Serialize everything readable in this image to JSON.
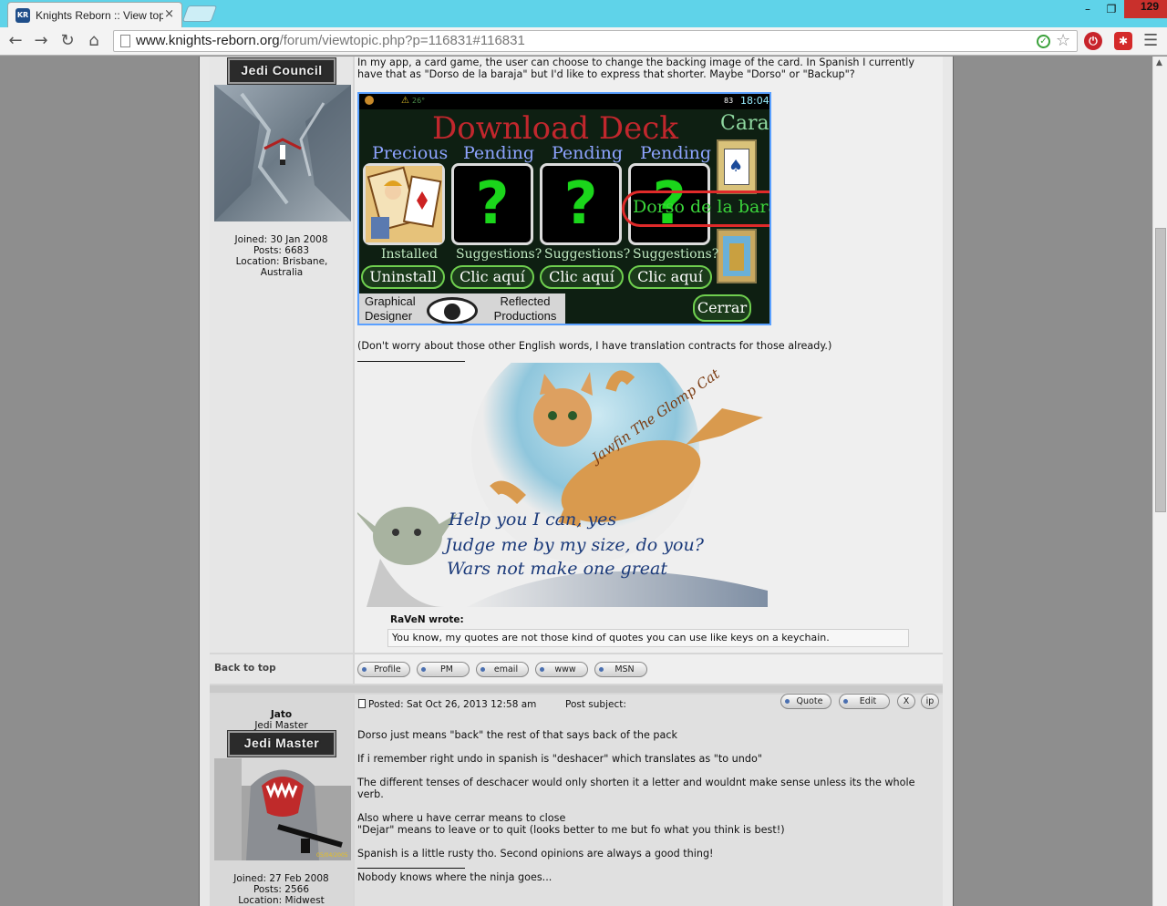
{
  "browser": {
    "tab_title": "Knights Reborn :: View top",
    "tab_favicon": "KR",
    "close_label": "×",
    "win_count": "129",
    "url_host": "www.knights-reborn.org",
    "url_path": "/forum/viewtopic.php?p=116831#116831"
  },
  "post1": {
    "rank_image_text": "Jedi Council",
    "joined": "Joined: 30 Jan 2008",
    "posts": "Posts: 6683",
    "location": "Location: Brisbane, Australia",
    "body_line1": "In my app, a card game, the user can choose to change the backing image of the card. In Spanish I currently",
    "body_line2": "have that as \"Dorso de la baraja\" but I'd like to express that shorter. Maybe \"Dorso\" or \"Backup\"?",
    "note": "(Don't worry about those other English words, I have translation contracts for those already.)",
    "back_to_top": "Back to top",
    "buttons": [
      "Profile",
      "PM",
      "email",
      "www",
      "MSN"
    ],
    "quote_author": "RaVeN wrote:",
    "quote_text": "You know, my quotes are not those kind of quotes you can use like keys on a keychain."
  },
  "deck": {
    "status_time": "18:04",
    "status_battery": "83",
    "status_temp": "26°",
    "title": "Download Deck",
    "cara": "Cara",
    "col_headers": [
      "Precious",
      "Pending",
      "Pending",
      "Pending"
    ],
    "col_sublabels": [
      "Installed",
      "Suggestions?",
      "Suggestions?",
      "Suggestions?"
    ],
    "col_buttons": [
      "Uninstall",
      "Clic aquí",
      "Clic aquí",
      "Clic aquí"
    ],
    "highlight_text": "Dorso de la baraja",
    "designer_left": "Graphical Designer",
    "designer_right": "Reflected Productions",
    "cerrar": "Cerrar"
  },
  "cat_art": {
    "line1": "Help you I can, yes",
    "line2": "Judge me by my size, do you?",
    "line3": "Wars not make one great",
    "cat_name": "Jawfin The Glomp Cat"
  },
  "post2": {
    "author": "Jato",
    "rank": "Jedi Master",
    "rank_image_text": "Jedi Master",
    "joined": "Joined: 27 Feb 2008",
    "posts": "Posts: 2566",
    "location": "Location: Midwest",
    "posted": "Posted: Sat Oct 26, 2013 12:58 am",
    "subject_label": "Post subject:",
    "quote_btn": "Quote",
    "edit_btn": "Edit",
    "x_btn": "X",
    "ip_btn": "ip",
    "avatar_stamp": "05/04/2005",
    "p1": "Dorso just means \"back\" the rest of that says back of the pack",
    "p2": "If i remember right undo in spanish is \"deshacer\" which translates as \"to undo\"",
    "p3a": "The different tenses of deschacer would only shorten it a letter and wouldnt make sense unless its the whole",
    "p3b": "verb.",
    "p4a": "Also where u have cerrar means to close",
    "p4b": "\"Dejar\" means to leave or to quit (looks better to me but fo what you think is best!)",
    "p5": "Spanish is a little rusty tho. Second opinions are always a good thing!",
    "sig": "Nobody knows where the ninja goes..."
  }
}
